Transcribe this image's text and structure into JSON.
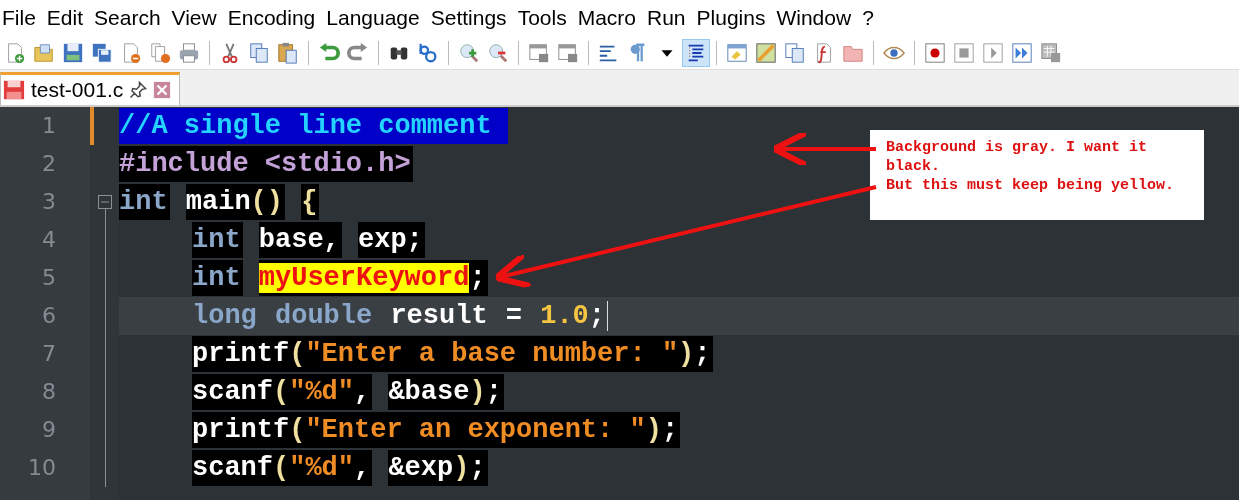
{
  "menu": [
    "File",
    "Edit",
    "Search",
    "View",
    "Encoding",
    "Language",
    "Settings",
    "Tools",
    "Macro",
    "Run",
    "Plugins",
    "Window",
    "?"
  ],
  "tabs": [
    {
      "label": "test-001.c",
      "selected": true,
      "pinned": false
    }
  ],
  "editor": {
    "lines": [
      {
        "number": "1",
        "current": false,
        "changed": true,
        "chunks": [
          [
            {
              "text": "//A single line comment",
              "kind": "comment"
            }
          ]
        ]
      },
      {
        "number": "2",
        "current": false,
        "changed": false,
        "chunks": [
          [
            {
              "text": "#include <stdio.h>",
              "kind": "preproc"
            }
          ]
        ]
      },
      {
        "number": "3",
        "current": false,
        "changed": false,
        "expanded": true,
        "chunks": [
          [
            {
              "text": "int",
              "kind": "keyword"
            }
          ],
          [
            {
              "text": "main",
              "kind": "ident"
            },
            {
              "text": "()",
              "kind": "paren"
            }
          ],
          [
            {
              "text": "{",
              "kind": "paren"
            }
          ]
        ],
        "children": [
          {
            "number": "4",
            "current": false,
            "changed": false,
            "chunks": [
              [
                {
                  "text": "int",
                  "kind": "keyword"
                }
              ],
              [
                {
                  "text": "base",
                  "kind": "ident"
                },
                {
                  "text": ",",
                  "kind": "punct"
                }
              ],
              [
                {
                  "text": "exp",
                  "kind": "ident"
                },
                {
                  "text": ";",
                  "kind": "punct"
                }
              ]
            ]
          },
          {
            "number": "5",
            "current": false,
            "changed": false,
            "chunks": [
              [
                {
                  "text": "int",
                  "kind": "keyword"
                }
              ],
              [
                {
                  "text": "myUserKeyword",
                  "kind": "user"
                },
                {
                  "text": ";",
                  "kind": "punct"
                }
              ]
            ]
          },
          {
            "number": "6",
            "current": true,
            "changed": false,
            "chunks": [
              [
                {
                  "text": "long",
                  "kind": "keyword"
                }
              ],
              [
                {
                  "text": "double",
                  "kind": "keyword"
                }
              ],
              [
                {
                  "text": "result",
                  "kind": "ident"
                }
              ],
              [
                {
                  "text": "=",
                  "kind": "punct"
                }
              ],
              [
                {
                  "text": "1.0",
                  "kind": "number"
                },
                {
                  "text": ";",
                  "kind": "punct"
                }
              ]
            ]
          },
          {
            "number": "7",
            "current": false,
            "changed": false,
            "chunks": [
              [
                {
                  "text": "printf",
                  "kind": "ident"
                },
                {
                  "text": "(",
                  "kind": "paren"
                },
                {
                  "text": "\"Enter a base number: \"",
                  "kind": "string"
                },
                {
                  "text": ")",
                  "kind": "paren"
                },
                {
                  "text": ";",
                  "kind": "punct"
                }
              ]
            ]
          },
          {
            "number": "8",
            "current": false,
            "changed": false,
            "chunks": [
              [
                {
                  "text": "scanf",
                  "kind": "ident"
                },
                {
                  "text": "(",
                  "kind": "paren"
                },
                {
                  "text": "\"%d\"",
                  "kind": "string"
                },
                {
                  "text": ",",
                  "kind": "punct"
                }
              ],
              [
                {
                  "text": "&base",
                  "kind": "ident"
                },
                {
                  "text": ")",
                  "kind": "paren"
                },
                {
                  "text": ";",
                  "kind": "punct"
                }
              ]
            ]
          },
          {
            "number": "9",
            "current": false,
            "changed": false,
            "chunks": [
              [
                {
                  "text": "printf",
                  "kind": "ident"
                },
                {
                  "text": "(",
                  "kind": "paren"
                },
                {
                  "text": "\"Enter an exponent: \"",
                  "kind": "string"
                },
                {
                  "text": ")",
                  "kind": "paren"
                },
                {
                  "text": ";",
                  "kind": "punct"
                }
              ]
            ]
          },
          {
            "number": "10",
            "current": false,
            "changed": false,
            "chunks": [
              [
                {
                  "text": "scanf",
                  "kind": "ident"
                },
                {
                  "text": "(",
                  "kind": "paren"
                },
                {
                  "text": "\"%d\"",
                  "kind": "string"
                },
                {
                  "text": ",",
                  "kind": "punct"
                }
              ],
              [
                {
                  "text": "&exp",
                  "kind": "ident"
                },
                {
                  "text": ")",
                  "kind": "paren"
                },
                {
                  "text": ";",
                  "kind": "punct"
                }
              ]
            ]
          }
        ]
      }
    ]
  },
  "note": {
    "paragraphs": [
      "Background is gray. I want it black.",
      "But this must keep being yellow."
    ]
  }
}
